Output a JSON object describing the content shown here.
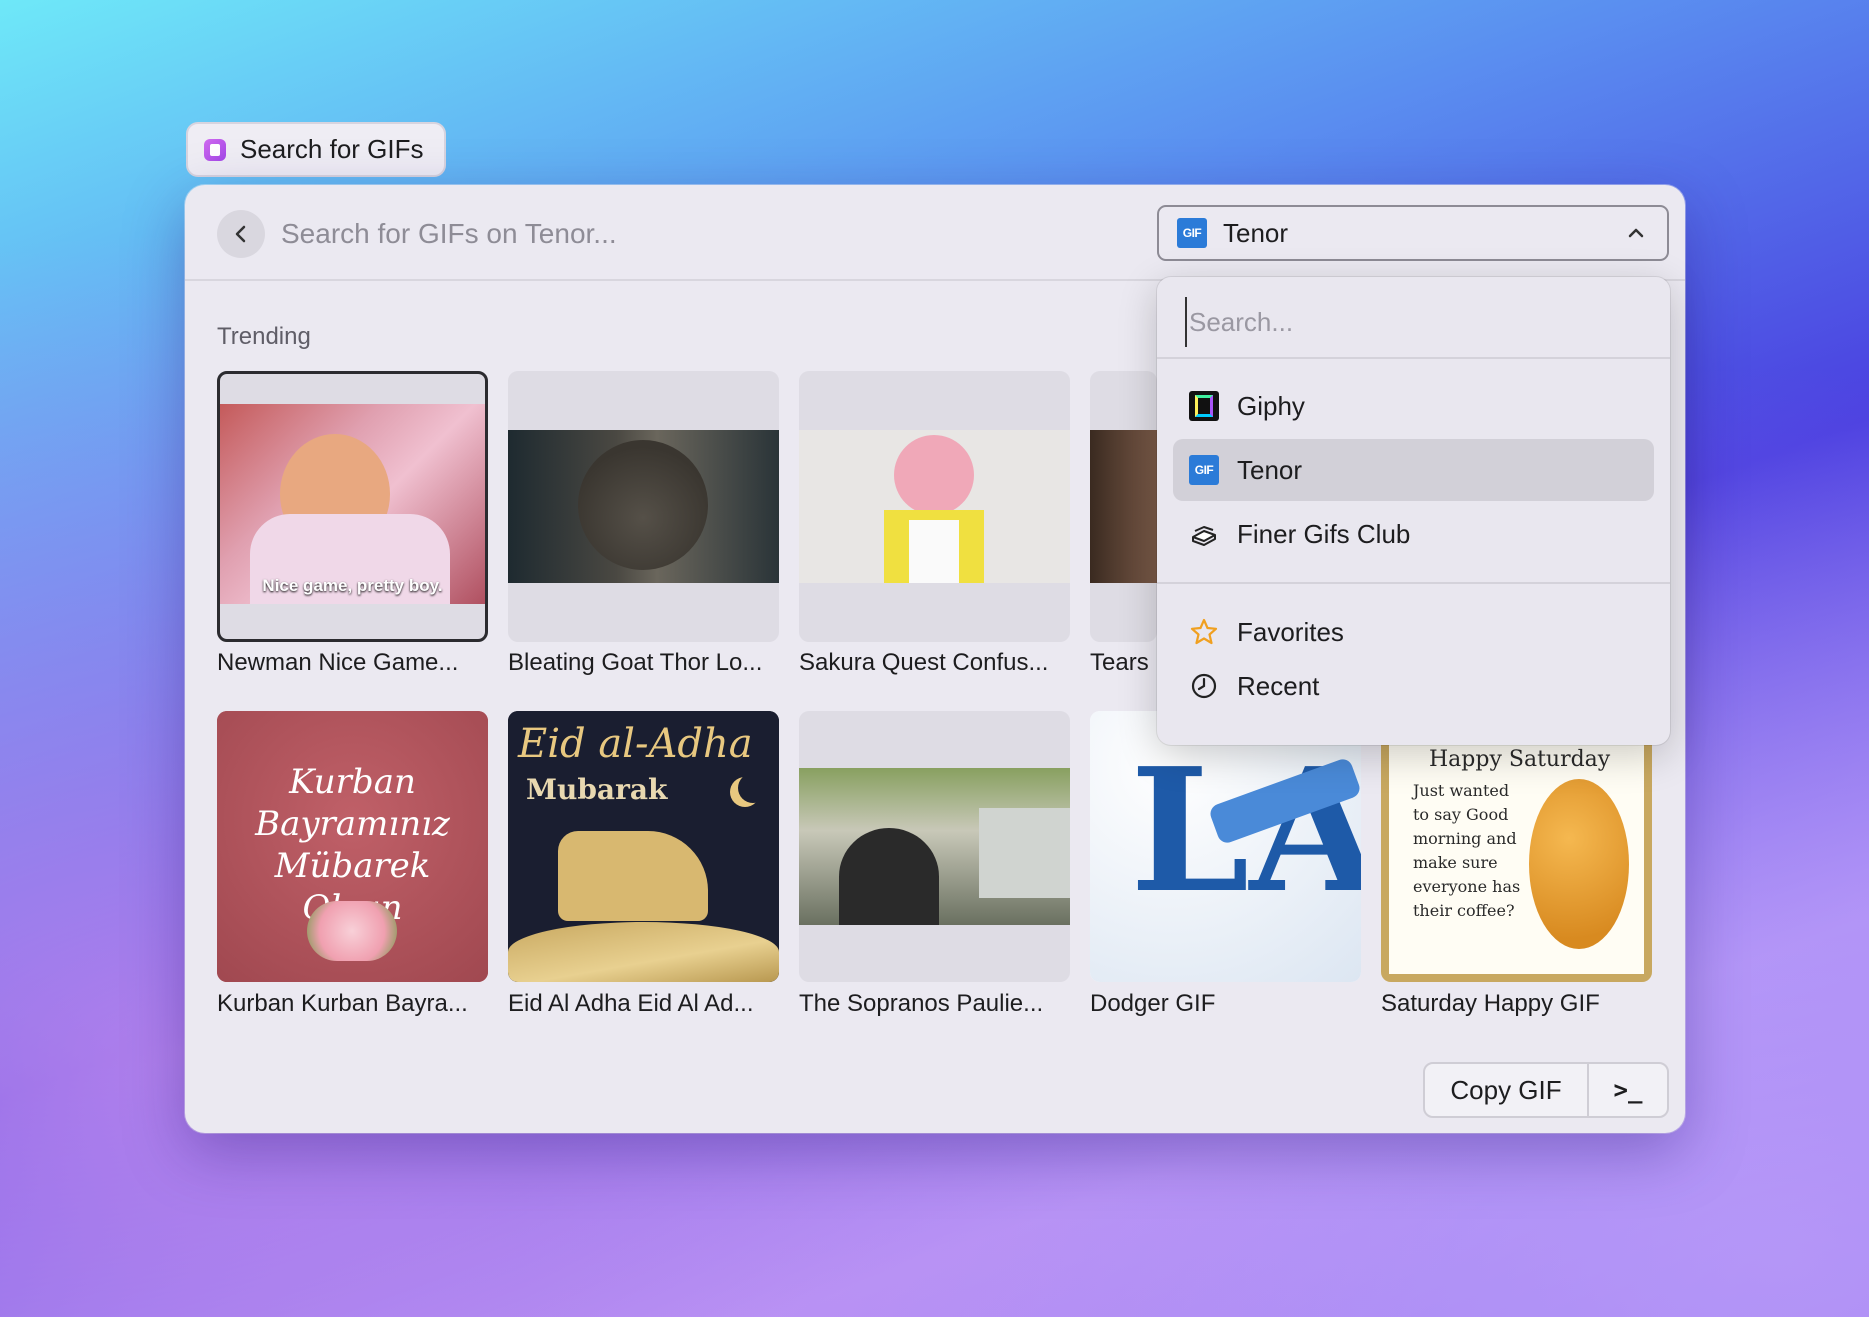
{
  "command_tab": {
    "label": "Search for GIFs"
  },
  "search": {
    "placeholder": "Search for GIFs on Tenor..."
  },
  "provider_dropdown": {
    "selected": "Tenor"
  },
  "section": {
    "title": "Trending"
  },
  "gifs": [
    {
      "caption": "Newman Nice Game...",
      "overlay_text": "Nice game, pretty boy."
    },
    {
      "caption": "Bleating Goat Thor Lo..."
    },
    {
      "caption": "Sakura Quest Confus..."
    },
    {
      "caption": "Tears"
    },
    {
      "caption": "Kurban Kurban Bayra...",
      "overlay_text": "Kurban Bayramınız Mübarek Olsun"
    },
    {
      "caption": "Eid Al Adha Eid Al Ad...",
      "overlay_text": "Eid al-Adha",
      "overlay_sub": "Mubarak"
    },
    {
      "caption": "The Sopranos Paulie..."
    },
    {
      "caption": "Dodger GIF",
      "overlay_text": "LA"
    },
    {
      "caption": "Saturday Happy GIF",
      "overlay_text": "Happy Saturday",
      "overlay_sub": "Just wanted to say Good morning and make sure everyone has their coffee?"
    }
  ],
  "actions": {
    "copy_label": "Copy GIF",
    "terminal_label": ">_"
  },
  "popover": {
    "search_placeholder": "Search...",
    "providers": [
      {
        "label": "Giphy",
        "icon": "giphy-icon"
      },
      {
        "label": "Tenor",
        "icon": "tenor-icon",
        "active": true,
        "icon_text": "GIF"
      },
      {
        "label": "Finer Gifs Club",
        "icon": "book-stack-icon"
      }
    ],
    "views": [
      {
        "label": "Favorites",
        "icon": "star-icon"
      },
      {
        "label": "Recent",
        "icon": "clock-icon"
      }
    ]
  }
}
